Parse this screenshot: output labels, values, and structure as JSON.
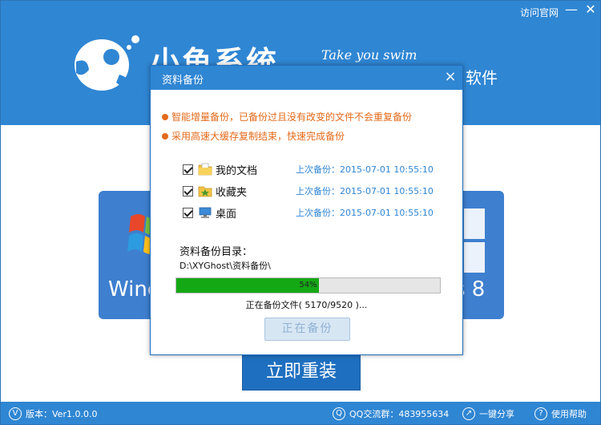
{
  "app": {
    "brand": "小鱼系统",
    "slogan": "Take you swim",
    "brand_tail": "软件",
    "visit_site": "访问官网",
    "minimize": "—",
    "close": "✕",
    "tile_left_text": "Wind",
    "tile_right_text": "s 8",
    "reinstall_button": "立即重装"
  },
  "footer": {
    "version": "版本：Ver1.0.0.0",
    "qq_group": "QQ交流群：483955634",
    "share": "一键分享",
    "help": "使用帮助",
    "icons": [
      "version-icon",
      "qq-icon",
      "share-icon",
      "help-icon"
    ]
  },
  "dialog": {
    "title": "资料备份",
    "close": "×",
    "notices": [
      "智能增量备份，已备份过且没有改变的文件不会重复备份",
      "采用高速大缓存复制结束，快速完成备份"
    ],
    "items": [
      {
        "name": "我的文档",
        "checked": true,
        "icon": "folder-doc-icon",
        "last_backup": "上次备份：2015-07-01 10:55:10"
      },
      {
        "name": "收藏夹",
        "checked": true,
        "icon": "favorites-icon",
        "last_backup": "上次备份：2015-07-01 10:55:10"
      },
      {
        "name": "桌面",
        "checked": true,
        "icon": "desktop-icon",
        "last_backup": "上次备份：2015-07-01 10:55:10"
      }
    ],
    "dir_label": "资料备份目录：",
    "dir_path": "D:\\XYGhost\\资料备份\\",
    "progress": {
      "percent": 54,
      "label": "54%"
    },
    "status": "正在备份文件( 5170/9520 )...",
    "busy_button": "正在备份"
  },
  "colors": {
    "header_blue": "#2f86d3",
    "notice_orange": "#e36a1a",
    "progress_green": "#15a815",
    "time_blue": "#2f86d3"
  }
}
